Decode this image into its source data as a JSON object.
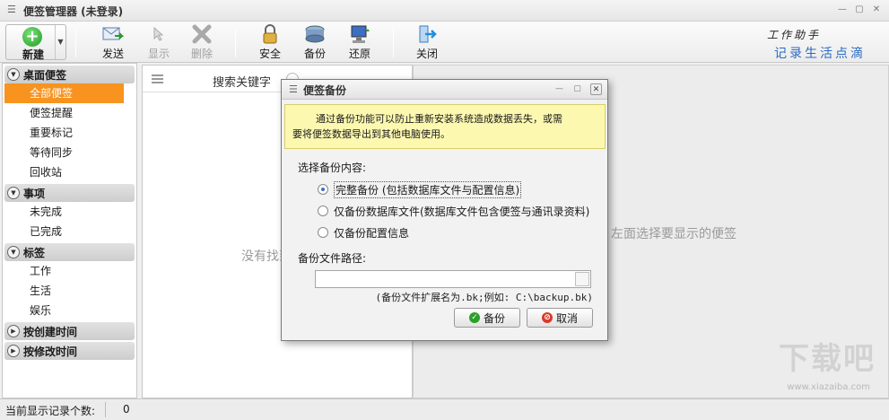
{
  "window": {
    "title": "便签管理器 (未登录)"
  },
  "toolbar": {
    "new_label": "新建",
    "send_label": "发送",
    "show_label": "显示",
    "delete_label": "删除",
    "security_label": "安全",
    "backup_label": "备份",
    "restore_label": "还原",
    "close_label": "关闭"
  },
  "brand": {
    "line1": "工作助手",
    "line2": "记录生活点滴"
  },
  "sidebar": {
    "groups": [
      {
        "label": "桌面便签",
        "items": [
          "全部便签",
          "便签提醒",
          "重要标记",
          "等待同步",
          "回收站"
        ]
      },
      {
        "label": "事项",
        "items": [
          "未完成",
          "已完成"
        ]
      },
      {
        "label": "标签",
        "items": [
          "工作",
          "生活",
          "娱乐"
        ]
      },
      {
        "label": "按创建时间",
        "items": []
      },
      {
        "label": "按修改时间",
        "items": []
      }
    ],
    "active_item": "全部便签"
  },
  "list": {
    "search_placeholder": "搜索关键字",
    "empty_text": "没有找到"
  },
  "detail": {
    "empty_text": "左面选择要显示的便签"
  },
  "statusbar": {
    "count_label": "当前显示记录个数:",
    "count_value": "0"
  },
  "watermark": {
    "text": "下载吧",
    "sub": "www.xiazaiba.com"
  },
  "dialog": {
    "title": "便签备份",
    "notice_line1": "通过备份功能可以防止重新安装系统造成数据丢失，或需",
    "notice_line2": "要将便签数据导出到其他电脑使用。",
    "select_label": "选择备份内容:",
    "options": [
      "完整备份 (包括数据库文件与配置信息)",
      "仅备份数据库文件(数据库文件包含便签与通讯录资料)",
      "仅备份配置信息"
    ],
    "selected_option": 0,
    "path_label": "备份文件路径:",
    "path_value": "",
    "hint": "(备份文件扩展名为.bk;例如: C:\\backup.bk)",
    "ok_label": "备份",
    "cancel_label": "取消"
  },
  "colors": {
    "active_item_bg": "#f7931e",
    "notice_bg": "#fdf8b0",
    "brand_blue": "#2a6bc4"
  }
}
